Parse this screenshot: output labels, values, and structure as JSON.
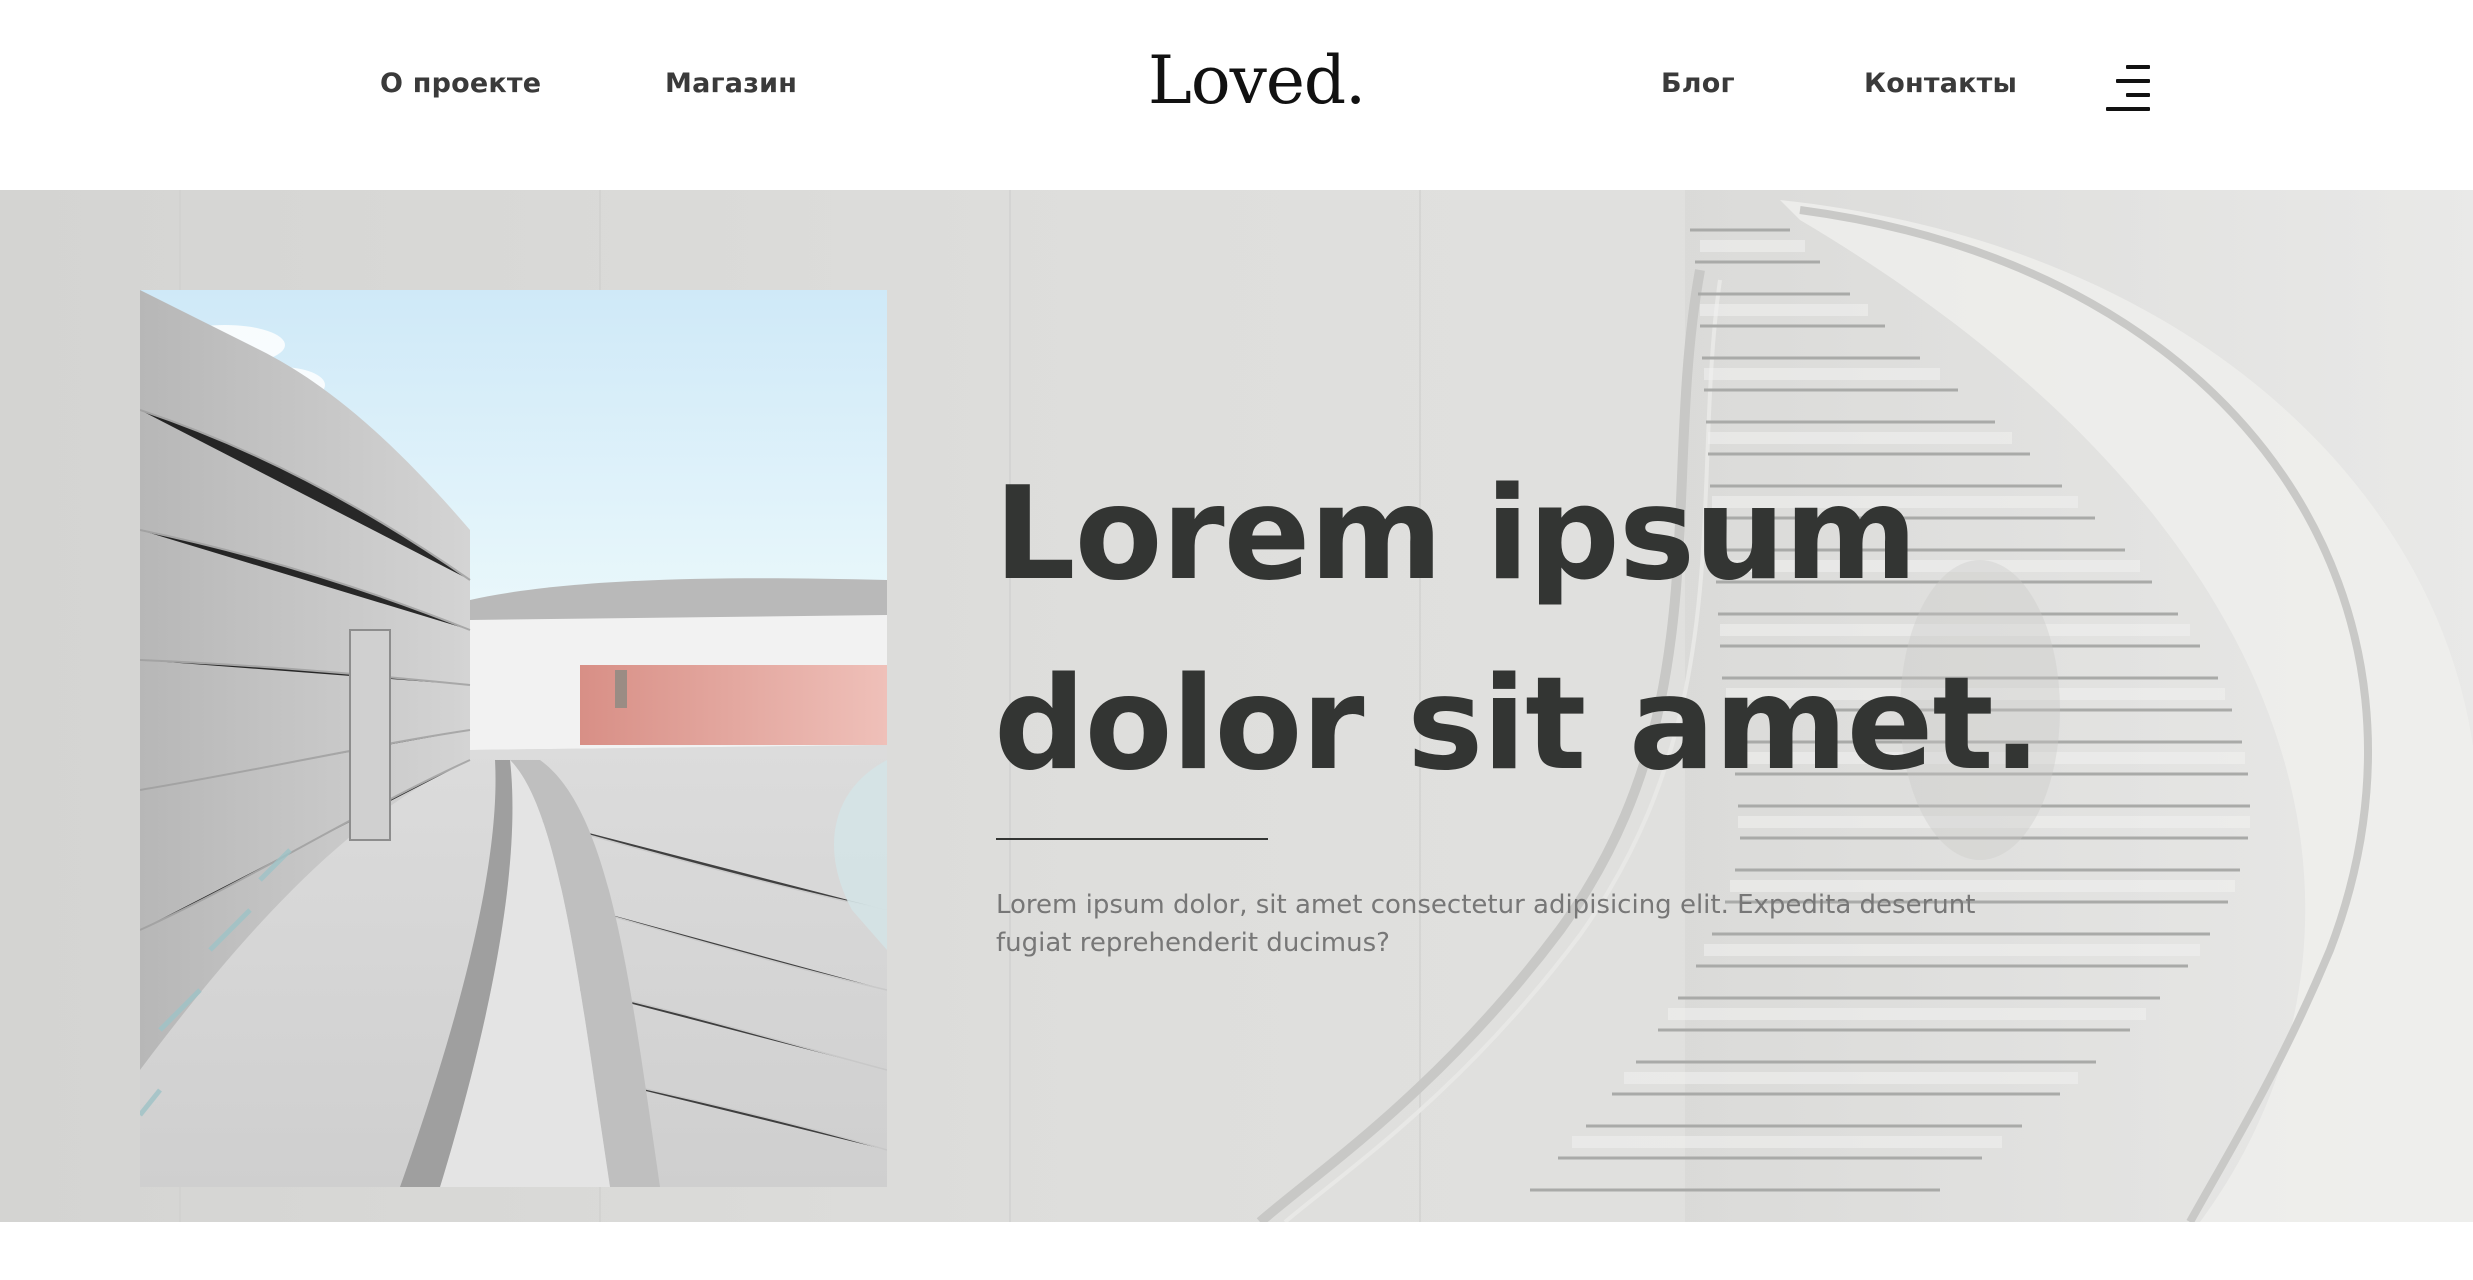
{
  "nav": {
    "left": [
      {
        "label": "О проекте"
      },
      {
        "label": "Магазин"
      }
    ],
    "logo": "Loved.",
    "right": [
      {
        "label": "Блог"
      },
      {
        "label": "Контакты"
      }
    ],
    "menu_icon": "hamburger-menu-icon"
  },
  "hero": {
    "title_line1": "Lorem ipsum",
    "title_line2": "dolor sit amet.",
    "text": "Lorem ipsum dolor, sit amet consectetur adipisicing elit. Expedita deserunt fugiat reprehenderit ducimus?",
    "background_image": "spiral-staircase-photo",
    "foreground_image": "architecture-courtyard-photo"
  },
  "colors": {
    "text_dark": "#333533",
    "text_muted": "#777777",
    "background": "#ffffff",
    "hero_background": "#dcdcda"
  }
}
